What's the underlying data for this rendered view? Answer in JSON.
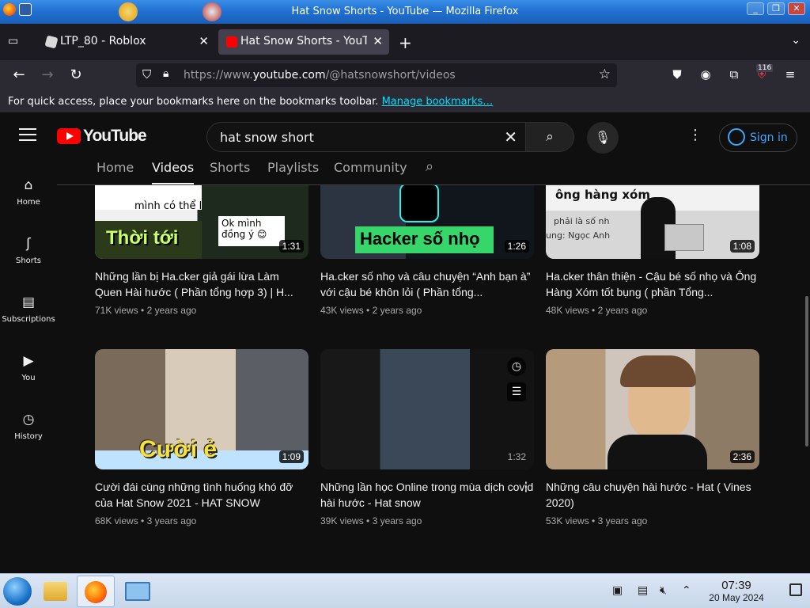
{
  "window": {
    "title": "Hat Snow Shorts - YouTube — Mozilla Firefox"
  },
  "tabs": [
    {
      "label": "LTP_80 - Roblox",
      "close": "✕"
    },
    {
      "label": "Hat Snow Shorts - YouTube",
      "close": "✕"
    }
  ],
  "nav": {
    "url_prefix": "https://www.",
    "url_host": "youtube.com",
    "url_path": "/@hatsnowshort/videos",
    "extension_badge": "116"
  },
  "bookmarks": {
    "message": "For quick access, place your bookmarks here on the bookmarks toolbar. ",
    "link": "Manage bookmarks…"
  },
  "youtube": {
    "logo_text": "YouTube",
    "search_query": "hat snow short",
    "sign_in": "Sign in",
    "channel_tabs": [
      "Home",
      "Videos",
      "Shorts",
      "Playlists",
      "Community"
    ],
    "guide": [
      {
        "label": "Home",
        "icon": "home-icon"
      },
      {
        "label": "Shorts",
        "icon": "shorts-icon"
      },
      {
        "label": "Subscriptions",
        "icon": "subscriptions-icon"
      },
      {
        "label": "You",
        "icon": "you-icon"
      },
      {
        "label": "History",
        "icon": "history-icon"
      }
    ],
    "videos": [
      {
        "title": "Những lần bị Ha.cker giả gái lừa Làm Quen Hài hước ( Phần tổng hợp 3) | H...",
        "views": "71K views",
        "age": "2 years ago",
        "duration": "1:31",
        "thumb_text": "Thời tới"
      },
      {
        "title": "Ha.cker số nhọ và câu chuyện “Anh bạn à” với cậu bé khôn lỏi ( Phần tổng...",
        "views": "43K views",
        "age": "2 years ago",
        "duration": "1:26",
        "thumb_text": "Hacker số nhọ"
      },
      {
        "title": "Ha.cker thân thiện - Cậu bé số nhọ và Ông Hàng Xóm tốt bụng ( phần Tổng...",
        "views": "48K views",
        "age": "2 years ago",
        "duration": "1:08",
        "thumb_text": "ông hàng xóm"
      },
      {
        "title": "Cười đái cùng những tình huống khó đỡ của Hat Snow 2021 - HAT SNOW",
        "views": "68K views",
        "age": "3 years ago",
        "duration": "1:09",
        "thumb_text": "Cười ẻ"
      },
      {
        "title": "Những lần học Online trong mùa dịch covid hài hước - Hat snow",
        "views": "39K views",
        "age": "3 years ago",
        "duration": "1:32",
        "thumb_text": ""
      },
      {
        "title": "Những câu chuyện hài hước - Hat ( Vines 2020)",
        "views": "53K views",
        "age": "3 years ago",
        "duration": "2:36",
        "thumb_text": ""
      }
    ],
    "thumb_extra": {
      "v0_caption": "Ok mình đồng ý 😊",
      "v0_top": "mình có thể l",
      "v2_sub": "phải là số nh",
      "v2_credit": "ung: Ngọc Anh"
    }
  },
  "taskbar": {
    "time": "07:39",
    "date": "20 May 2024"
  },
  "colors": {
    "youtube_red": "#ff0000",
    "link_blue": "#3ea6ff",
    "firefox_bg": "#1c1b22"
  }
}
